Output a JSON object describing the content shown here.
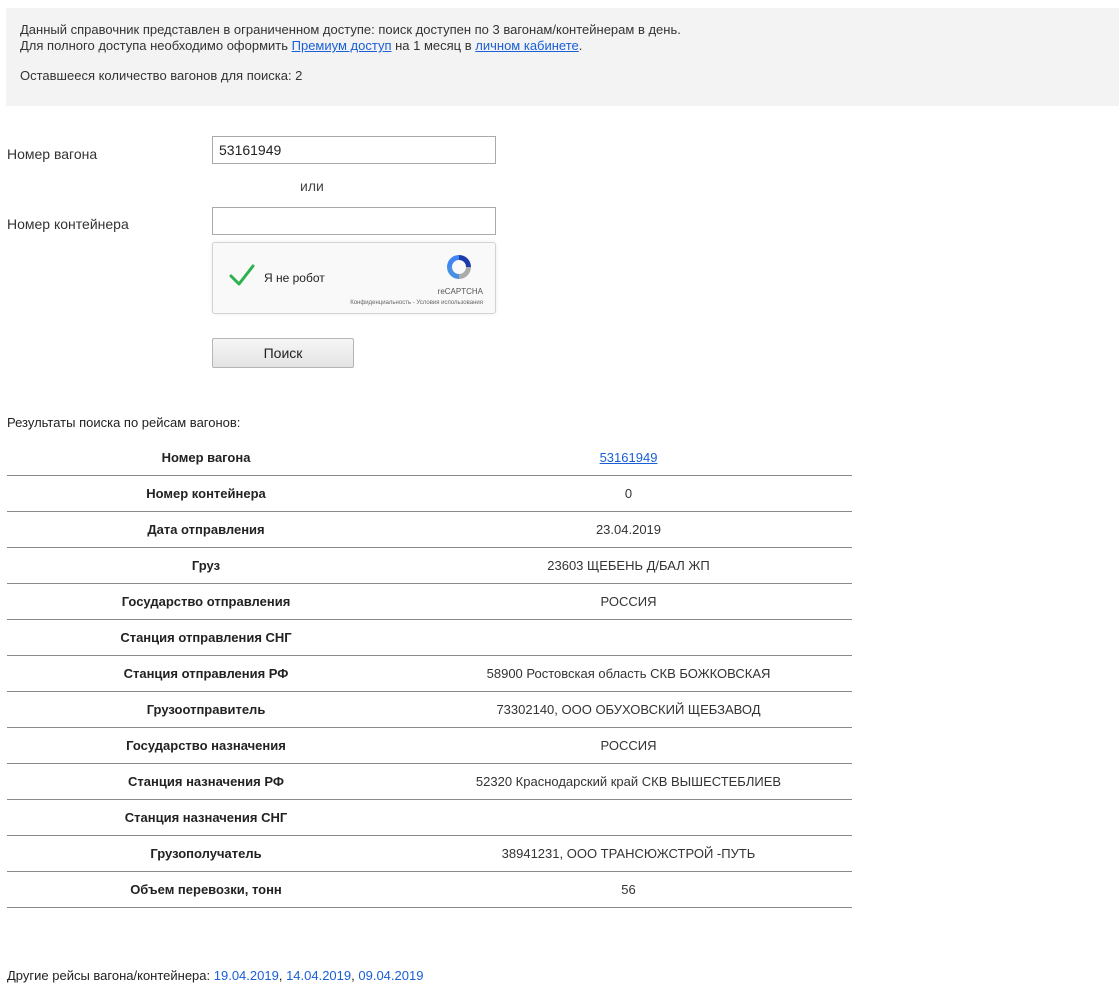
{
  "notice": {
    "line1": "Данный справочник представлен в ограниченном доступе: поиск доступен по 3 вагонам/контейнерам в день.",
    "line2_before": "Для полного доступа необходимо оформить ",
    "premium_link": "Премиум доступ",
    "line2_middle": " на 1 месяц в ",
    "cabinet_link": "личном кабинете",
    "line2_after": ".",
    "remaining": "Оставшееся количество вагонов для поиска: 2"
  },
  "form": {
    "wagon_label": "Номер вагона",
    "wagon_value": "53161949",
    "or_text": "или",
    "container_label": "Номер контейнера",
    "container_value": "",
    "captcha": {
      "label": "Я не робот",
      "brand": "reCAPTCHA",
      "terms": "Конфиденциальность - Условия использования"
    },
    "search_button": "Поиск"
  },
  "results": {
    "title": "Результаты поиска по рейсам вагонов:",
    "rows": [
      {
        "key": "Номер вагона",
        "value": "53161949"
      },
      {
        "key": "Номер контейнера",
        "value": "0"
      },
      {
        "key": "Дата отправления",
        "value": "23.04.2019"
      },
      {
        "key": "Груз",
        "value": "23603 ЩЕБЕНЬ Д/БАЛ ЖП"
      },
      {
        "key": "Государство отправления",
        "value": "РОССИЯ"
      },
      {
        "key": "Станция отправления СНГ",
        "value": ""
      },
      {
        "key": "Станция отправления РФ",
        "value": "58900 Ростовская область СКВ БОЖКОВСКАЯ"
      },
      {
        "key": "Грузоотправитель",
        "value": "73302140, ООО ОБУХОВСКИЙ ЩЕБЗАВОД"
      },
      {
        "key": "Государство назначения",
        "value": "РОССИЯ"
      },
      {
        "key": "Станция назначения РФ",
        "value": "52320 Краснодарский край СКВ ВЫШЕСТЕБЛИЕВ"
      },
      {
        "key": "Станция назначения СНГ",
        "value": ""
      },
      {
        "key": "Грузополучатель",
        "value": "38941231, ООО ТРАНСЮЖСТРОЙ -ПУТЬ"
      },
      {
        "key": "Объем перевозки, тонн",
        "value": "56"
      }
    ]
  },
  "other_trips": {
    "label": "Другие рейсы вагона/контейнера: ",
    "dates": [
      "19.04.2019",
      "14.04.2019",
      "09.04.2019"
    ],
    "separator": ", "
  },
  "colors": {
    "link": "#1a5fd6",
    "notice_bg": "#f3f3f3",
    "check": "#2bb24c"
  }
}
